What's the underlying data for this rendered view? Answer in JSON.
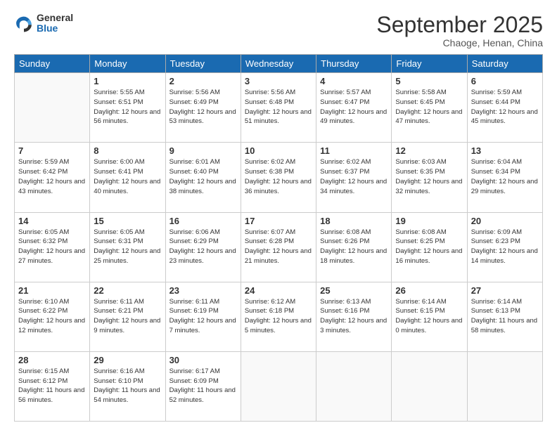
{
  "header": {
    "logo": {
      "general": "General",
      "blue": "Blue"
    },
    "title": "September 2025",
    "subtitle": "Chaoge, Henan, China"
  },
  "days_of_week": [
    "Sunday",
    "Monday",
    "Tuesday",
    "Wednesday",
    "Thursday",
    "Friday",
    "Saturday"
  ],
  "weeks": [
    [
      {
        "day": "",
        "empty": true
      },
      {
        "day": "1",
        "sunrise": "Sunrise: 5:55 AM",
        "sunset": "Sunset: 6:51 PM",
        "daylight": "Daylight: 12 hours and 56 minutes."
      },
      {
        "day": "2",
        "sunrise": "Sunrise: 5:56 AM",
        "sunset": "Sunset: 6:49 PM",
        "daylight": "Daylight: 12 hours and 53 minutes."
      },
      {
        "day": "3",
        "sunrise": "Sunrise: 5:56 AM",
        "sunset": "Sunset: 6:48 PM",
        "daylight": "Daylight: 12 hours and 51 minutes."
      },
      {
        "day": "4",
        "sunrise": "Sunrise: 5:57 AM",
        "sunset": "Sunset: 6:47 PM",
        "daylight": "Daylight: 12 hours and 49 minutes."
      },
      {
        "day": "5",
        "sunrise": "Sunrise: 5:58 AM",
        "sunset": "Sunset: 6:45 PM",
        "daylight": "Daylight: 12 hours and 47 minutes."
      },
      {
        "day": "6",
        "sunrise": "Sunrise: 5:59 AM",
        "sunset": "Sunset: 6:44 PM",
        "daylight": "Daylight: 12 hours and 45 minutes."
      }
    ],
    [
      {
        "day": "7",
        "sunrise": "Sunrise: 5:59 AM",
        "sunset": "Sunset: 6:42 PM",
        "daylight": "Daylight: 12 hours and 43 minutes."
      },
      {
        "day": "8",
        "sunrise": "Sunrise: 6:00 AM",
        "sunset": "Sunset: 6:41 PM",
        "daylight": "Daylight: 12 hours and 40 minutes."
      },
      {
        "day": "9",
        "sunrise": "Sunrise: 6:01 AM",
        "sunset": "Sunset: 6:40 PM",
        "daylight": "Daylight: 12 hours and 38 minutes."
      },
      {
        "day": "10",
        "sunrise": "Sunrise: 6:02 AM",
        "sunset": "Sunset: 6:38 PM",
        "daylight": "Daylight: 12 hours and 36 minutes."
      },
      {
        "day": "11",
        "sunrise": "Sunrise: 6:02 AM",
        "sunset": "Sunset: 6:37 PM",
        "daylight": "Daylight: 12 hours and 34 minutes."
      },
      {
        "day": "12",
        "sunrise": "Sunrise: 6:03 AM",
        "sunset": "Sunset: 6:35 PM",
        "daylight": "Daylight: 12 hours and 32 minutes."
      },
      {
        "day": "13",
        "sunrise": "Sunrise: 6:04 AM",
        "sunset": "Sunset: 6:34 PM",
        "daylight": "Daylight: 12 hours and 29 minutes."
      }
    ],
    [
      {
        "day": "14",
        "sunrise": "Sunrise: 6:05 AM",
        "sunset": "Sunset: 6:32 PM",
        "daylight": "Daylight: 12 hours and 27 minutes."
      },
      {
        "day": "15",
        "sunrise": "Sunrise: 6:05 AM",
        "sunset": "Sunset: 6:31 PM",
        "daylight": "Daylight: 12 hours and 25 minutes."
      },
      {
        "day": "16",
        "sunrise": "Sunrise: 6:06 AM",
        "sunset": "Sunset: 6:29 PM",
        "daylight": "Daylight: 12 hours and 23 minutes."
      },
      {
        "day": "17",
        "sunrise": "Sunrise: 6:07 AM",
        "sunset": "Sunset: 6:28 PM",
        "daylight": "Daylight: 12 hours and 21 minutes."
      },
      {
        "day": "18",
        "sunrise": "Sunrise: 6:08 AM",
        "sunset": "Sunset: 6:26 PM",
        "daylight": "Daylight: 12 hours and 18 minutes."
      },
      {
        "day": "19",
        "sunrise": "Sunrise: 6:08 AM",
        "sunset": "Sunset: 6:25 PM",
        "daylight": "Daylight: 12 hours and 16 minutes."
      },
      {
        "day": "20",
        "sunrise": "Sunrise: 6:09 AM",
        "sunset": "Sunset: 6:23 PM",
        "daylight": "Daylight: 12 hours and 14 minutes."
      }
    ],
    [
      {
        "day": "21",
        "sunrise": "Sunrise: 6:10 AM",
        "sunset": "Sunset: 6:22 PM",
        "daylight": "Daylight: 12 hours and 12 minutes."
      },
      {
        "day": "22",
        "sunrise": "Sunrise: 6:11 AM",
        "sunset": "Sunset: 6:21 PM",
        "daylight": "Daylight: 12 hours and 9 minutes."
      },
      {
        "day": "23",
        "sunrise": "Sunrise: 6:11 AM",
        "sunset": "Sunset: 6:19 PM",
        "daylight": "Daylight: 12 hours and 7 minutes."
      },
      {
        "day": "24",
        "sunrise": "Sunrise: 6:12 AM",
        "sunset": "Sunset: 6:18 PM",
        "daylight": "Daylight: 12 hours and 5 minutes."
      },
      {
        "day": "25",
        "sunrise": "Sunrise: 6:13 AM",
        "sunset": "Sunset: 6:16 PM",
        "daylight": "Daylight: 12 hours and 3 minutes."
      },
      {
        "day": "26",
        "sunrise": "Sunrise: 6:14 AM",
        "sunset": "Sunset: 6:15 PM",
        "daylight": "Daylight: 12 hours and 0 minutes."
      },
      {
        "day": "27",
        "sunrise": "Sunrise: 6:14 AM",
        "sunset": "Sunset: 6:13 PM",
        "daylight": "Daylight: 11 hours and 58 minutes."
      }
    ],
    [
      {
        "day": "28",
        "sunrise": "Sunrise: 6:15 AM",
        "sunset": "Sunset: 6:12 PM",
        "daylight": "Daylight: 11 hours and 56 minutes."
      },
      {
        "day": "29",
        "sunrise": "Sunrise: 6:16 AM",
        "sunset": "Sunset: 6:10 PM",
        "daylight": "Daylight: 11 hours and 54 minutes."
      },
      {
        "day": "30",
        "sunrise": "Sunrise: 6:17 AM",
        "sunset": "Sunset: 6:09 PM",
        "daylight": "Daylight: 11 hours and 52 minutes."
      },
      {
        "day": "",
        "empty": true
      },
      {
        "day": "",
        "empty": true
      },
      {
        "day": "",
        "empty": true
      },
      {
        "day": "",
        "empty": true
      }
    ]
  ]
}
